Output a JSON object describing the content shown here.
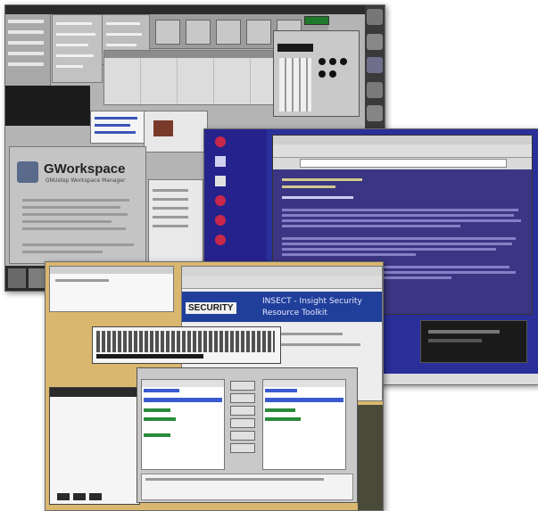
{
  "gnustep": {
    "app_name": "GWorkspace",
    "app_subtitle": "GNUstep Workspace Manager",
    "colors": {
      "background": "#b8b8b8",
      "dark_panel": "#1c1c1c",
      "title": "#2a2a2a"
    }
  },
  "browser": {
    "colors": {
      "desktop": "#2a2f9a",
      "page_bg": "#3a3683",
      "toolbar": "#d9d9d9",
      "dock": "#1d1d1d"
    },
    "icons": [
      "home-icon",
      "terminal-icon",
      "network-icon",
      "clock-icon",
      "globe-icon",
      "dock-app-icon"
    ]
  },
  "insect": {
    "logo_word": "SECURITY",
    "headline_line1": "INSECT - Insight Security",
    "headline_line2": "Resource Toolkit",
    "colors": {
      "desktop": "#d9b76e",
      "banner": "#1f3f9a",
      "panel_bg": "#eeeeee"
    }
  }
}
